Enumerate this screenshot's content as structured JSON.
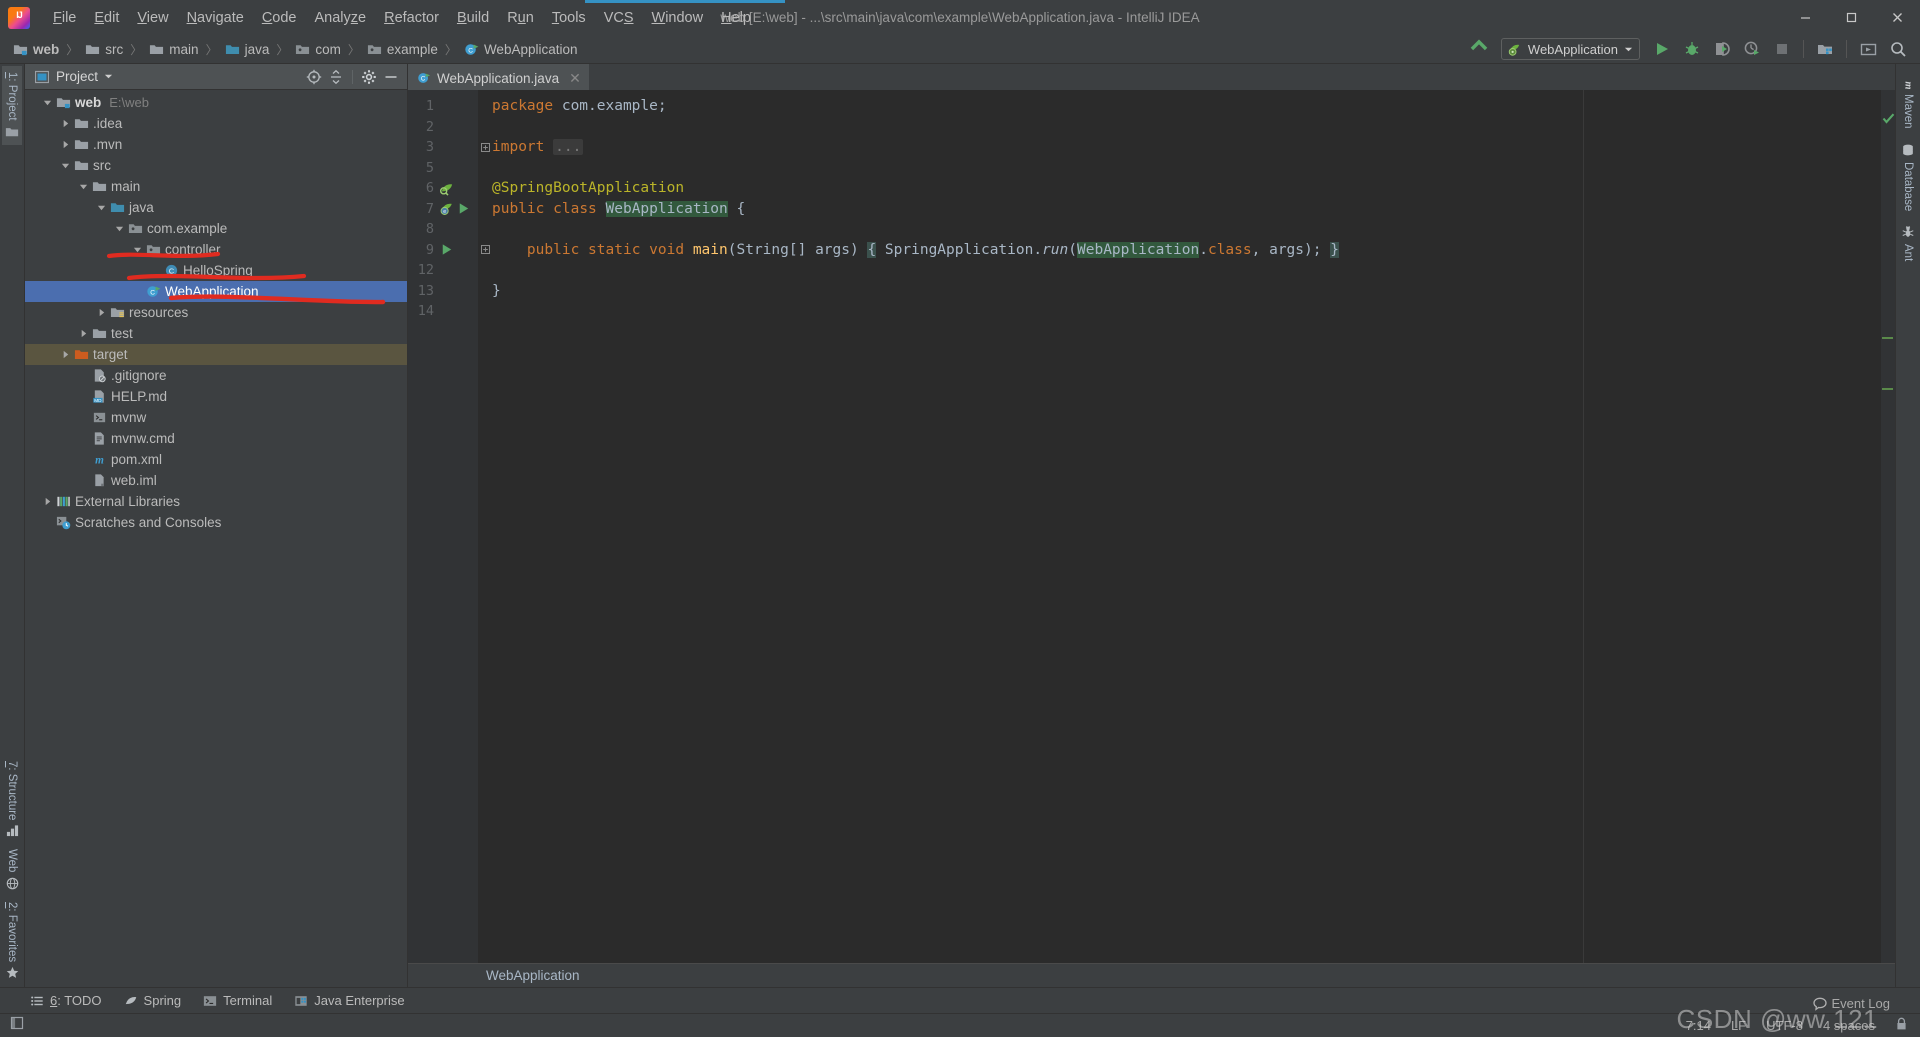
{
  "window": {
    "title": "web [E:\\web] - ...\\src\\main\\java\\com\\example\\WebApplication.java - IntelliJ IDEA",
    "minimize": "—",
    "maximize": "❐",
    "close": "✕"
  },
  "menu": {
    "items": [
      {
        "label": "File",
        "mnemonic": "F"
      },
      {
        "label": "Edit",
        "mnemonic": "E"
      },
      {
        "label": "View",
        "mnemonic": "V"
      },
      {
        "label": "Navigate",
        "mnemonic": "N"
      },
      {
        "label": "Code",
        "mnemonic": "C"
      },
      {
        "label": "Analyze",
        "mnemonic": "z"
      },
      {
        "label": "Refactor",
        "mnemonic": "R"
      },
      {
        "label": "Build",
        "mnemonic": "B"
      },
      {
        "label": "Run",
        "mnemonic": "u"
      },
      {
        "label": "Tools",
        "mnemonic": "T"
      },
      {
        "label": "VCS",
        "mnemonic": "S"
      },
      {
        "label": "Window",
        "mnemonic": "W"
      },
      {
        "label": "Help",
        "mnemonic": "H"
      }
    ]
  },
  "navbar": {
    "crumbs": [
      {
        "label": "web",
        "icon": "module-folder-icon",
        "bold": true
      },
      {
        "label": "src",
        "icon": "folder-icon",
        "bold": false
      },
      {
        "label": "main",
        "icon": "folder-icon",
        "bold": false
      },
      {
        "label": "java",
        "icon": "source-folder-icon",
        "bold": false
      },
      {
        "label": "com",
        "icon": "package-icon",
        "bold": false
      },
      {
        "label": "example",
        "icon": "package-icon",
        "bold": false
      },
      {
        "label": "WebApplication",
        "icon": "spring-class-icon",
        "bold": false
      }
    ],
    "separator": "〉"
  },
  "toolbar": {
    "update_project_label": "Update Project",
    "run_config_name": "WebApplication",
    "buttons": [
      {
        "name": "run-button",
        "title": "Run"
      },
      {
        "name": "debug-button",
        "title": "Debug"
      },
      {
        "name": "run-with-coverage-button",
        "title": "Run with Coverage"
      },
      {
        "name": "profile-button",
        "title": "Profile"
      },
      {
        "name": "stop-button",
        "title": "Stop"
      },
      {
        "name": "project-structure-button",
        "title": "Project Structure"
      },
      {
        "name": "select-opened-file-button",
        "title": "Select Opened File"
      },
      {
        "name": "search-everywhere-button",
        "title": "Search Everywhere"
      }
    ]
  },
  "left_strip": {
    "top": [
      {
        "label": "1: Project",
        "mnemonic": "1",
        "active": true
      }
    ],
    "bottom": [
      {
        "label": "7: Structure",
        "mnemonic": "7"
      },
      {
        "label": "Web",
        "mnemonic": ""
      },
      {
        "label": "2: Favorites",
        "mnemonic": "2"
      }
    ]
  },
  "right_strip": {
    "items": [
      {
        "label": "Maven",
        "icon": "maven-icon"
      },
      {
        "label": "Database",
        "icon": "database-icon"
      },
      {
        "label": "Ant",
        "icon": "ant-icon"
      }
    ]
  },
  "project_panel": {
    "title": "Project",
    "dropdown_caret": "▼",
    "actions": [
      {
        "name": "scroll-from-source-button",
        "title": "Select Opened File"
      },
      {
        "name": "collapse-all-button",
        "title": "Collapse All"
      },
      {
        "name": "settings-gear-button",
        "title": "Settings"
      },
      {
        "name": "hide-panel-button",
        "title": "Hide"
      }
    ],
    "tree": [
      {
        "label": "web",
        "path": "E:\\web",
        "indent": 0,
        "arrow": "open",
        "icon": "module-folder-icon",
        "bold": true,
        "state": "normal"
      },
      {
        "label": ".idea",
        "path": "",
        "indent": 1,
        "arrow": "closed",
        "icon": "folder-icon",
        "bold": false,
        "state": "normal"
      },
      {
        "label": ".mvn",
        "path": "",
        "indent": 1,
        "arrow": "closed",
        "icon": "folder-icon",
        "bold": false,
        "state": "normal"
      },
      {
        "label": "src",
        "path": "",
        "indent": 1,
        "arrow": "open",
        "icon": "folder-icon",
        "bold": false,
        "state": "normal"
      },
      {
        "label": "main",
        "path": "",
        "indent": 2,
        "arrow": "open",
        "icon": "folder-icon",
        "bold": false,
        "state": "normal"
      },
      {
        "label": "java",
        "path": "",
        "indent": 3,
        "arrow": "open",
        "icon": "source-folder-icon",
        "bold": false,
        "state": "normal"
      },
      {
        "label": "com.example",
        "path": "",
        "indent": 4,
        "arrow": "open",
        "icon": "package-icon",
        "bold": false,
        "state": "normal"
      },
      {
        "label": "controller",
        "path": "",
        "indent": 5,
        "arrow": "open",
        "icon": "package-icon",
        "bold": false,
        "state": "normal"
      },
      {
        "label": "HelloSpring",
        "path": "",
        "indent": 6,
        "arrow": "none",
        "icon": "java-class-icon",
        "bold": false,
        "state": "normal"
      },
      {
        "label": "WebApplication",
        "path": "",
        "indent": 5,
        "arrow": "none",
        "icon": "spring-class-icon",
        "bold": false,
        "state": "selected"
      },
      {
        "label": "resources",
        "path": "",
        "indent": 3,
        "arrow": "closed",
        "icon": "resources-folder-icon",
        "bold": false,
        "state": "normal"
      },
      {
        "label": "test",
        "path": "",
        "indent": 2,
        "arrow": "closed",
        "icon": "folder-icon",
        "bold": false,
        "state": "normal"
      },
      {
        "label": "target",
        "path": "",
        "indent": 1,
        "arrow": "closed",
        "icon": "excluded-folder-icon",
        "bold": false,
        "state": "excluded"
      },
      {
        "label": ".gitignore",
        "path": "",
        "indent": 2,
        "arrow": "none",
        "icon": "gitignore-file-icon",
        "bold": false,
        "state": "normal"
      },
      {
        "label": "HELP.md",
        "path": "",
        "indent": 2,
        "arrow": "none",
        "icon": "markdown-file-icon",
        "bold": false,
        "state": "normal"
      },
      {
        "label": "mvnw",
        "path": "",
        "indent": 2,
        "arrow": "none",
        "icon": "shell-file-icon",
        "bold": false,
        "state": "normal"
      },
      {
        "label": "mvnw.cmd",
        "path": "",
        "indent": 2,
        "arrow": "none",
        "icon": "cmd-file-icon",
        "bold": false,
        "state": "normal"
      },
      {
        "label": "pom.xml",
        "path": "",
        "indent": 2,
        "arrow": "none",
        "icon": "maven-pom-icon",
        "bold": false,
        "state": "normal"
      },
      {
        "label": "web.iml",
        "path": "",
        "indent": 2,
        "arrow": "none",
        "icon": "iml-file-icon",
        "bold": false,
        "state": "normal"
      },
      {
        "label": "External Libraries",
        "path": "",
        "indent": 0,
        "arrow": "closed",
        "icon": "libraries-icon",
        "bold": false,
        "state": "normal"
      },
      {
        "label": "Scratches and Consoles",
        "path": "",
        "indent": 0,
        "arrow": "none",
        "icon": "scratches-icon",
        "bold": false,
        "state": "normal"
      }
    ]
  },
  "editor": {
    "tab": {
      "label": "WebApplication.java",
      "icon": "spring-class-icon",
      "close": "✕"
    },
    "line_numbers": [
      "1",
      "2",
      "3",
      "5",
      "6",
      "7",
      "8",
      "9",
      "12",
      "13",
      "14"
    ],
    "lines": [
      "package com.example;",
      "",
      "import ...",
      "",
      "@SpringBootApplication",
      "public class WebApplication {",
      "",
      "    public static void main(String[] args) { SpringApplication.run(WebApplication.class, args); }",
      "",
      "}",
      ""
    ],
    "breadcrumb": "WebApplication",
    "gutter_icons": [
      {
        "line": "6",
        "icon": "spring-bean-icon"
      },
      {
        "line": "7",
        "icon": "spring-boot-icon"
      },
      {
        "line": "7",
        "icon": "run-gutter-icon"
      },
      {
        "line": "9",
        "icon": "run-gutter-icon"
      }
    ],
    "fold_markers": [
      {
        "line": "3",
        "symbol": "+"
      },
      {
        "line": "9",
        "symbol": "+"
      }
    ]
  },
  "bottom_tabs": [
    {
      "label": "6: TODO",
      "mnemonic": "6",
      "icon": "todo-icon"
    },
    {
      "label": "Spring",
      "mnemonic": "",
      "icon": "spring-leaf-icon"
    },
    {
      "label": "Terminal",
      "mnemonic": "",
      "icon": "terminal-icon"
    },
    {
      "label": "Java Enterprise",
      "mnemonic": "",
      "icon": "java-enterprise-icon"
    }
  ],
  "statusbar": {
    "event_log": "Event Log",
    "caret_position": "7:14",
    "line_separator": "LF",
    "encoding": "UTF-8",
    "indent": "4 spaces",
    "lock_icon": "read-only-lock-icon"
  },
  "watermark": "CSDN @ww 121",
  "colors": {
    "accent_blue": "#3592c4",
    "selection_blue": "#4b6eaf",
    "panel_bg": "#3c3f41",
    "editor_bg": "#2b2b2b",
    "keyword_orange": "#cc7832",
    "annotation_yellow": "#bbb529",
    "green_run": "#59a869",
    "marker_red": "#e03030",
    "excluded_brown": "#5a5540"
  }
}
